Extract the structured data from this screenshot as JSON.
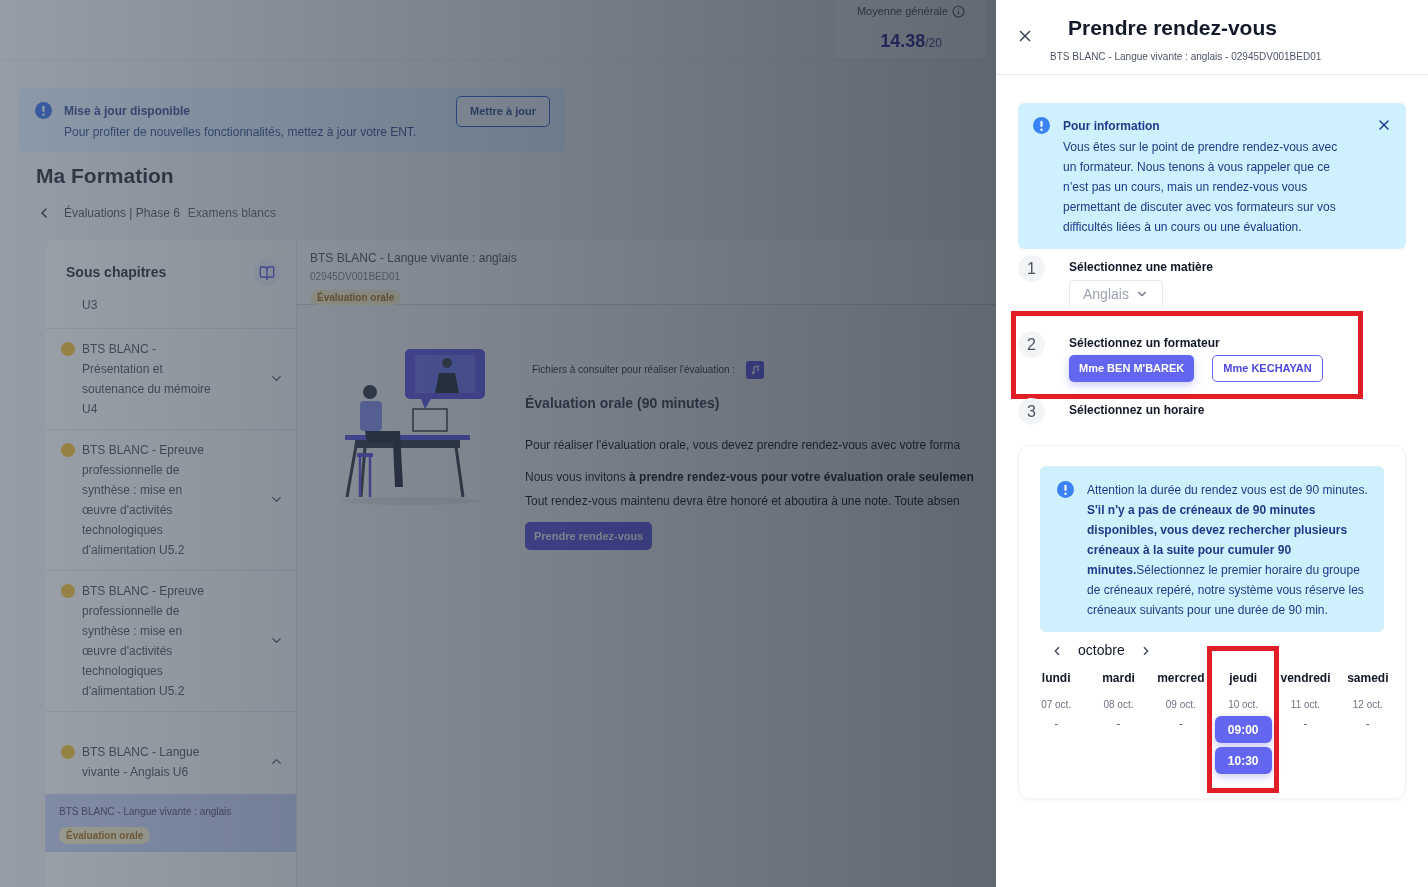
{
  "header": {
    "average_label": "Moyenne générale",
    "average_value": "14.38",
    "average_scale": "/20"
  },
  "update_banner": {
    "title": "Mise à jour disponible",
    "text": "Pour profiter de nouvelles fonctionnalités, mettez à jour votre ENT.",
    "button": "Mettre à jour"
  },
  "page_title": "Ma Formation",
  "breadcrumb": {
    "path": "Évaluations | Phase 6",
    "current": "Examens blancs"
  },
  "sidebar": {
    "title": "Sous chapitres",
    "top_fragment": "U3",
    "items": [
      {
        "label": "BTS BLANC - Présentation et soutenance du mémoire U4",
        "expanded": false
      },
      {
        "label": "BTS BLANC - Epreuve professionnelle de synthèse : mise en œuvre d'activités technologiques d'alimentation U5.2",
        "expanded": false
      },
      {
        "label": "BTS BLANC - Epreuve professionnelle de synthèse : mise en œuvre d'activités technologiques d'alimentation U5.2",
        "expanded": false
      },
      {
        "label": "BTS BLANC - Langue vivante - Anglais U6",
        "expanded": true
      }
    ],
    "sub_items": [
      {
        "label": "BTS BLANC - Langue vivante : anglais",
        "badge": "Évaluation orale",
        "selected": true
      }
    ]
  },
  "evaluation": {
    "title": "BTS BLANC - Langue vivante : anglais",
    "code": "02945DV001BED01",
    "badge": "Évaluation orale",
    "files_label": "Fichiers à consulter pour réaliser l'évaluation :",
    "heading": "Évaluation orale (90 minutes)",
    "paragraphs": [
      "Pour réaliser l'évaluation orale, vous devez prendre rendez-vous avec votre forma",
      "Nous vous invitons **à prendre rendez-vous pour votre évaluation orale seulemen**",
      "Tout rendez-vous maintenu devra être honoré et aboutira à une note. Toute absen"
    ],
    "button": "Prendre rendez-vous"
  },
  "drawer": {
    "title": "Prendre rendez-vous",
    "subtitle": "BTS BLANC - Langue vivante : anglais - 02945DV001BED01",
    "info": {
      "title": "Pour information",
      "text": "Vous êtes sur le point de prendre rendez-vous avec un formateur. Nous tenons à vous rappeler que ce n’est pas un cours, mais un rendez-vous vous permettant de discuter avec vos formateurs sur vos difficultés liées à un cours ou une évaluation."
    },
    "steps": [
      {
        "number": "1",
        "label": "Sélectionnez une matière",
        "highlighted": false
      },
      {
        "number": "2",
        "label": "Sélectionnez un formateur",
        "highlighted": true
      },
      {
        "number": "3",
        "label": "Sélectionnez un horaire",
        "highlighted": false
      }
    ],
    "subject": "Anglais",
    "trainers": [
      {
        "label": "Mme BEN M'BAREK",
        "selected": true
      },
      {
        "label": "Mme KECHAYAN",
        "selected": false
      }
    ],
    "warning": {
      "intro": "Attention la durée du rendez vous est de 90 minutes.",
      "text": "**S'il n'y a pas de créneaux de 90 minutes disponibles, vous devez rechercher plusieurs créneaux à la suite pour cumuler 90 minutes.**Sélectionnez le premier horaire du groupe de créneaux repéré, notre système vous réserve les créneaux suivants pour une durée de 90 min."
    },
    "month": "octobre",
    "days": [
      {
        "name": "lundi",
        "date": "07 oct.",
        "no_slot": "-",
        "highlighted": false
      },
      {
        "name": "mardi",
        "date": "08 oct.",
        "no_slot": "-",
        "highlighted": false
      },
      {
        "name": "mercred",
        "date": "09 oct.",
        "no_slot": "-",
        "highlighted": false
      },
      {
        "name": "jeudi",
        "date": "10 oct.",
        "slots": [
          "09:00",
          "10:30"
        ],
        "highlighted": true
      },
      {
        "name": "vendredi",
        "date": "11 oct.",
        "no_slot": "-",
        "highlighted": false
      },
      {
        "name": "samedi",
        "date": "12 oct.",
        "no_slot": "-",
        "highlighted": false
      }
    ]
  }
}
